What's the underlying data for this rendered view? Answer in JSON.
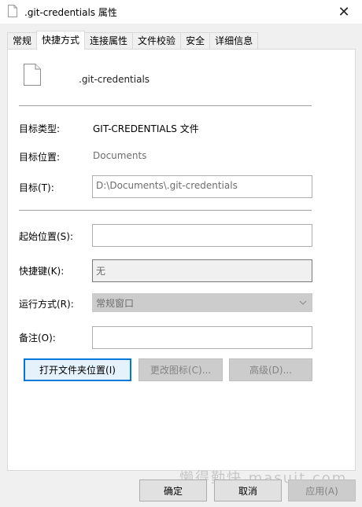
{
  "window": {
    "title": ".git-credentials 属性",
    "close_glyph": "✕"
  },
  "tabs": [
    {
      "label": "常规",
      "active": false
    },
    {
      "label": "快捷方式",
      "active": true
    },
    {
      "label": "连接属性",
      "active": false
    },
    {
      "label": "文件校验",
      "active": false
    },
    {
      "label": "安全",
      "active": false
    },
    {
      "label": "详细信息",
      "active": false
    }
  ],
  "file": {
    "name": ".git-credentials",
    "icon": "document-icon"
  },
  "fields": {
    "target_type": {
      "label": "目标类型:",
      "value": "GIT-CREDENTIALS 文件"
    },
    "target_location": {
      "label": "目标位置:",
      "value": "Documents"
    },
    "target": {
      "label": "目标(T):",
      "value": "D:\\Documents\\.git-credentials"
    },
    "start_in": {
      "label": "起始位置(S):",
      "value": ""
    },
    "shortcut_key": {
      "label": "快捷键(K):",
      "value": "无"
    },
    "run": {
      "label": "运行方式(R):",
      "value": "常规窗口"
    },
    "comment": {
      "label": "备注(O):",
      "value": ""
    }
  },
  "actions": {
    "open_location": "打开文件夹位置(I)",
    "change_icon": "更改图标(C)...",
    "advanced": "高级(D)..."
  },
  "footer": {
    "ok": "确定",
    "cancel": "取消",
    "apply": "应用(A)"
  },
  "watermark": "懒得勤快 masuit.com"
}
